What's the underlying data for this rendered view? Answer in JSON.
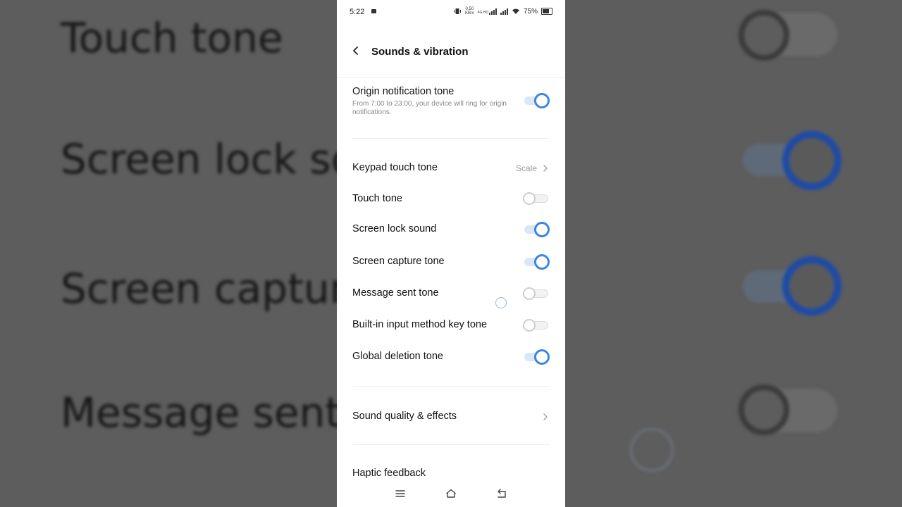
{
  "background": {
    "labels": [
      "Touch tone",
      "Screen lock sou",
      "Screen capture",
      "Message sent t"
    ]
  },
  "status_bar": {
    "time": "5:22",
    "speed_value": "0.50",
    "speed_unit": "KB/s",
    "network": "4G HD",
    "battery": "75%"
  },
  "header": {
    "title": "Sounds & vibration"
  },
  "settings": {
    "origin": {
      "title": "Origin notification tone",
      "subtitle": "From 7:00 to 23:00, your device will ring for origin notifications.",
      "enabled": true
    },
    "keypad": {
      "title": "Keypad touch tone",
      "value": "Scale"
    },
    "touch_tone": {
      "title": "Touch tone",
      "enabled": false
    },
    "screen_lock": {
      "title": "Screen lock sound",
      "enabled": true
    },
    "screen_capture": {
      "title": "Screen capture tone",
      "enabled": true
    },
    "message_sent": {
      "title": "Message sent tone",
      "enabled": false
    },
    "input_method": {
      "title": "Built-in input method key tone",
      "enabled": false
    },
    "global_deletion": {
      "title": "Global deletion tone",
      "enabled": true
    },
    "sound_quality": {
      "title": "Sound quality & effects"
    },
    "haptic": {
      "title": "Haptic feedback"
    }
  },
  "colors": {
    "accent": "#3b86e0",
    "panel": "#ffffff"
  },
  "icons": {
    "back": "chevron-left-icon",
    "chevron": "chevron-right-icon",
    "menu": "menu-icon",
    "home": "home-icon",
    "return": "return-icon"
  }
}
